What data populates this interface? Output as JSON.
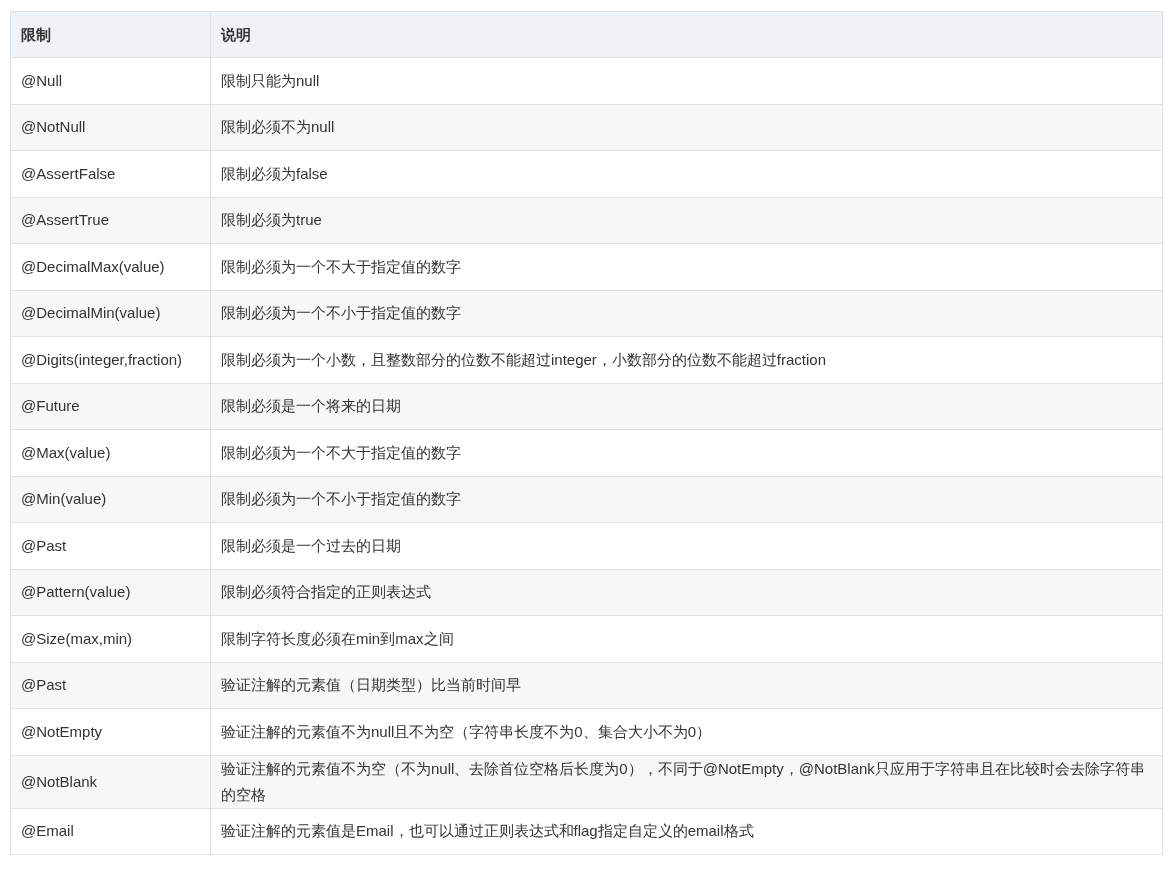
{
  "table": {
    "columns": [
      "限制",
      "说明"
    ],
    "rows": [
      [
        "@Null",
        "限制只能为null"
      ],
      [
        "@NotNull",
        "限制必须不为null"
      ],
      [
        "@AssertFalse",
        "限制必须为false"
      ],
      [
        "@AssertTrue",
        "限制必须为true"
      ],
      [
        "@DecimalMax(value)",
        "限制必须为一个不大于指定值的数字"
      ],
      [
        "@DecimalMin(value)",
        "限制必须为一个不小于指定值的数字"
      ],
      [
        "@Digits(integer,fraction)",
        "限制必须为一个小数，且整数部分的位数不能超过integer，小数部分的位数不能超过fraction"
      ],
      [
        "@Future",
        "限制必须是一个将来的日期"
      ],
      [
        "@Max(value)",
        "限制必须为一个不大于指定值的数字"
      ],
      [
        "@Min(value)",
        "限制必须为一个不小于指定值的数字"
      ],
      [
        "@Past",
        "限制必须是一个过去的日期"
      ],
      [
        "@Pattern(value)",
        "限制必须符合指定的正则表达式"
      ],
      [
        "@Size(max,min)",
        "限制字符长度必须在min到max之间"
      ],
      [
        "@Past",
        "验证注解的元素值（日期类型）比当前时间早"
      ],
      [
        "@NotEmpty",
        "验证注解的元素值不为null且不为空（字符串长度不为0、集合大小不为0）"
      ],
      [
        "@NotBlank",
        "验证注解的元素值不为空（不为null、去除首位空格后长度为0），不同于@NotEmpty，@NotBlank只应用于字符串且在比较时会去除字符串的空格"
      ],
      [
        "@Email",
        "验证注解的元素值是Email，也可以通过正则表达式和flag指定自定义的email格式"
      ]
    ]
  }
}
